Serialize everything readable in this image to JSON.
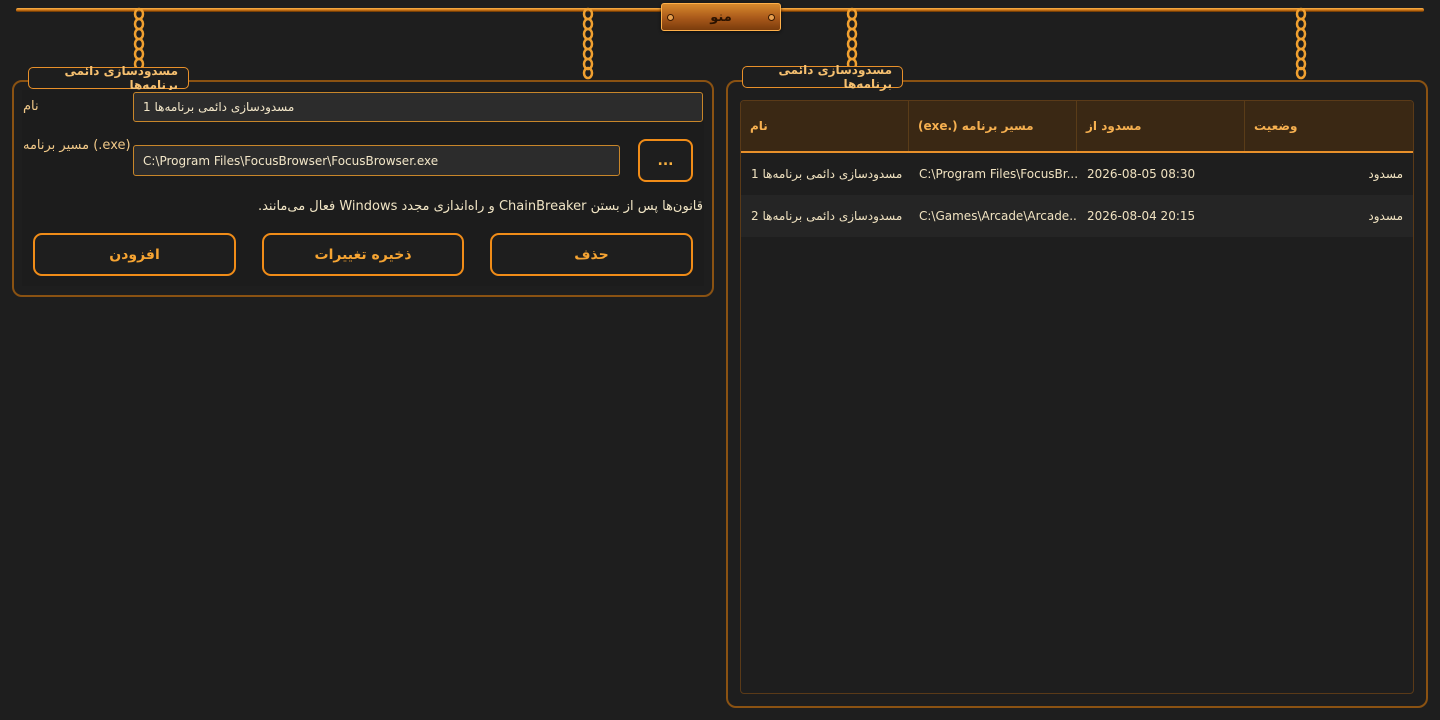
{
  "menu": {
    "label": "منو"
  },
  "left_panel": {
    "title": "مسدودسازی دائمی برنامه‌ها",
    "name_label": "نام",
    "name_value": "مسدودسازی دائمی برنامه‌ها 1",
    "path_label": "مسیر برنامه (.exe)",
    "path_value": "C:\\Program Files\\FocusBrowser\\FocusBrowser.exe",
    "browse_label": "...",
    "note": "قانون‌ها پس از بستن ChainBreaker و راه‌اندازی مجدد Windows فعال می‌مانند.",
    "buttons": {
      "delete": "حذف",
      "save": "ذخیره تغییرات",
      "add": "افزودن"
    }
  },
  "right_panel": {
    "title": "مسدودسازی دائمی برنامه‌ها",
    "columns": [
      "نام",
      "مسیر برنامه (.exe)",
      "مسدود از",
      "وضعیت"
    ],
    "rows": [
      {
        "name": "مسدودسازی دائمی برنامه‌ها 1",
        "path": "C:\\Program Files\\FocusBr...",
        "blocked_since": "2026-08-05 08:30",
        "status": "مسدود"
      },
      {
        "name": "مسدودسازی دائمی برنامه‌ها 2",
        "path": "C:\\Games\\Arcade\\Arcade....",
        "blocked_since": "2026-08-04 20:15",
        "status": "مسدود"
      }
    ]
  },
  "theme": {
    "accent": "#f08c18",
    "background": "#1e1e1e",
    "header_bg": "#3a2814"
  }
}
